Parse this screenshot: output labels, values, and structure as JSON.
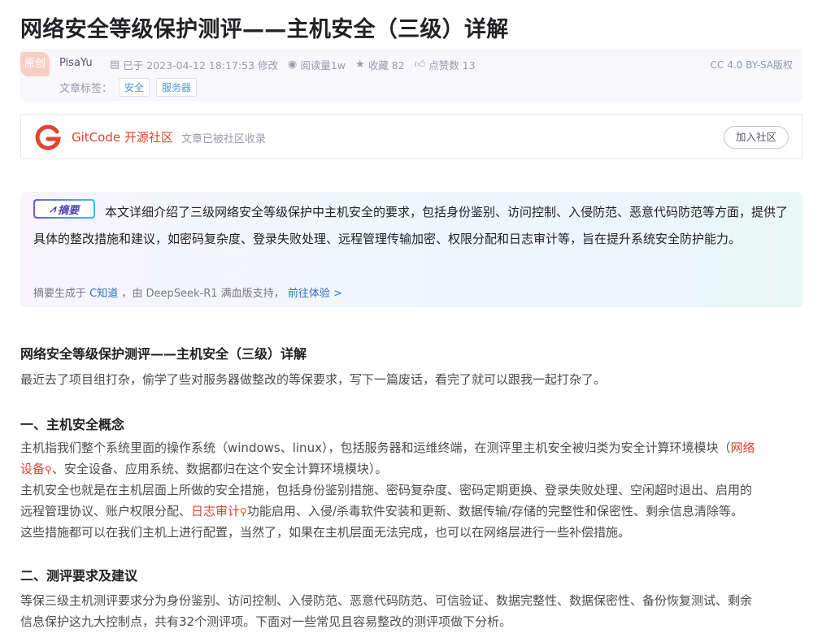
{
  "title": "网络安全等级保护测评——主机安全（三级）详解",
  "meta": {
    "badge": "原创",
    "author": "PisaYu",
    "date_text": "已于 2023-04-12 18:17:53 修改",
    "views": "阅读量1w",
    "favorites": "收藏 82",
    "likes": "点赞数 13",
    "license": "CC 4.0 BY-SA版权",
    "tags_label": "文章标签：",
    "tags": [
      "安全",
      "服务器"
    ]
  },
  "gitcode": {
    "name": "GitCode 开源社区",
    "desc": "文章已被社区收录",
    "join": "加入社区"
  },
  "summary": {
    "badge": "摘要",
    "text": "本文详细介绍了三级网络安全等级保护中主机安全的要求，包括身份鉴别、访问控制、入侵防范、恶意代码防范等方面，提供了具体的整改措施和建议，如密码复杂度、登录失败处理、远程管理传输加密、权限分配和日志审计等，旨在提升系统安全防护能力。",
    "foot_prefix": "摘要生成于",
    "foot_link1": "C知道",
    "foot_middle": "，由 DeepSeek-R1 满血版支持，",
    "foot_link2": "前往体验 >"
  },
  "article": {
    "heading": "网络安全等级保护测评——主机安全（三级）详解",
    "intro": "最近去了项目组打杂，偷学了些对服务器做整改的等保要求，写下一篇废话，看完了就可以跟我一起打杂了。",
    "s1_title": "一、主机安全概念",
    "s1_p1a": "主机指我们整个系统里面的操作系统（windows、linux），包括服务器和运维终端，在测评里主机安全被归类为安全计算环境模块（",
    "s1_kw1a": "网络",
    "s1_kw1b": "设备",
    "s1_p1b": "、安全设备、应用系统、数据都归在这个安全计算环境模块）。",
    "s1_p2a": "主机安全也就是在主机层面上所做的安全措施，包括身份鉴别措施、密码复杂度、密码定期更换、登录失败处理、空闲超时退出、启用的",
    "s1_p2b": "远程管理协议、账户权限分配、",
    "s1_kw2": "日志审计",
    "s1_p2c": "功能启用、入侵/杀毒软件安装和更新、数据传输/存储的完整性和保密性、剩余信息清除等。",
    "s1_p3": "这些措施都可以在我们主机上进行配置，当然了，如果在主机层面无法完成，也可以在网络层进行一些补偿措施。",
    "s2_title": "二、测评要求及建议",
    "s2_p1a": "等保三级主机测评要求分为身份鉴别、访问控制、入侵防范、恶意代码防范、可信验证、数据完整性、数据保密性、备份恢复测试、剩余",
    "s2_p1b": "信息保护这九大控制点，共有32个测评项。下面对一些常见且容易整改的测评项做下分析。"
  }
}
